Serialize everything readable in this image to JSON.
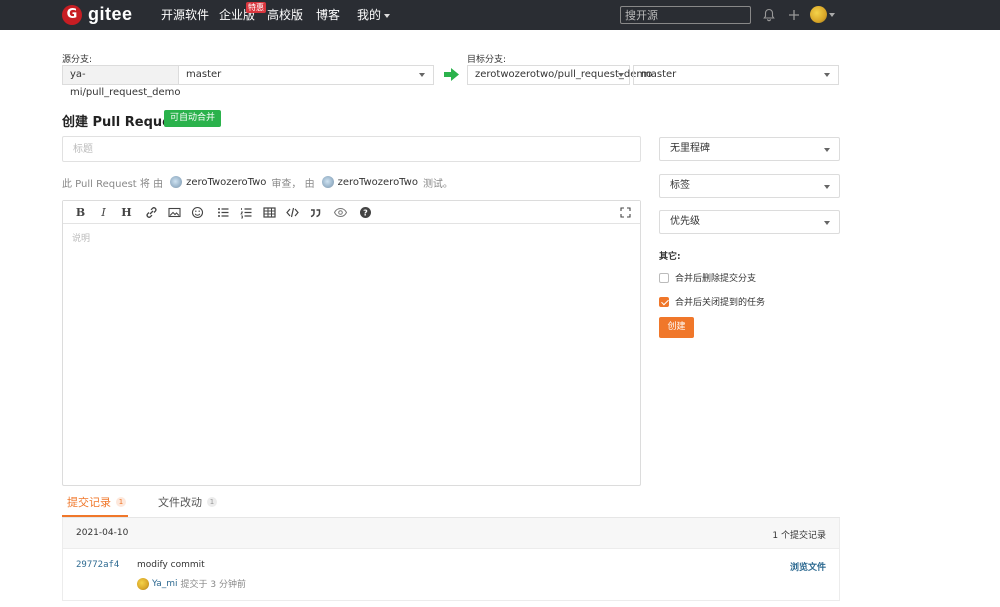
{
  "nav": {
    "logo_letter": "G",
    "logo_text": "gitee",
    "items": [
      "开源软件",
      "企业版",
      "高校版",
      "博客",
      "我的"
    ],
    "badge": "特惠",
    "search_placeholder": "搜开源"
  },
  "branches": {
    "source_label": "源分支:",
    "source_repo": "ya-mi/pull_request_demo",
    "source_branch": "master",
    "target_label": "目标分支:",
    "target_repo": "zerotwozerotwo/pull_request_demo",
    "target_branch": "master"
  },
  "pr": {
    "heading": "创建 Pull Request",
    "auto_merge_badge": "可自动合并",
    "title_placeholder": "标题",
    "reviewer_prefix": "此 Pull Request 将 由",
    "reviewer_name": "zeroTwozeroTwo",
    "reviewer_mid": "审查， 由",
    "tester_name": "zeroTwozeroTwo",
    "tester_suffix": "测试。",
    "description_placeholder": "说明"
  },
  "editor_toolbar": {
    "icons": [
      "bold-icon",
      "italic-icon",
      "heading-icon",
      "link-icon",
      "image-icon",
      "emoji-icon",
      "unordered-list-icon",
      "ordered-list-icon",
      "table-icon",
      "code-icon",
      "quote-icon",
      "preview-icon",
      "help-icon",
      "fullscreen-icon"
    ]
  },
  "sidebar": {
    "milestone": "无里程碑",
    "labels": "标签",
    "priority": "优先级",
    "other_label": "其它:",
    "option_delete_branch": "合并后删除提交分支",
    "option_delete_branch_checked": false,
    "option_close_issues": "合并后关闭提到的任务",
    "option_close_issues_checked": true,
    "create_button": "创建"
  },
  "tabs": [
    {
      "label": "提交记录",
      "count": "1",
      "active": true
    },
    {
      "label": "文件改动",
      "count": "1",
      "active": false
    }
  ],
  "commits": {
    "date": "2021-04-10",
    "count_text": "1 个提交记录",
    "items": [
      {
        "sha": "29772af4",
        "message": "modify commit",
        "author": "Ya_mi",
        "time": "提交于 3 分钟前",
        "browse": "浏览文件"
      }
    ]
  },
  "colors": {
    "accent": "#f0772a",
    "nav_bg": "#2a2d33",
    "brand": "#c71d23",
    "success": "#2bb24c",
    "link": "#2e6a91"
  }
}
